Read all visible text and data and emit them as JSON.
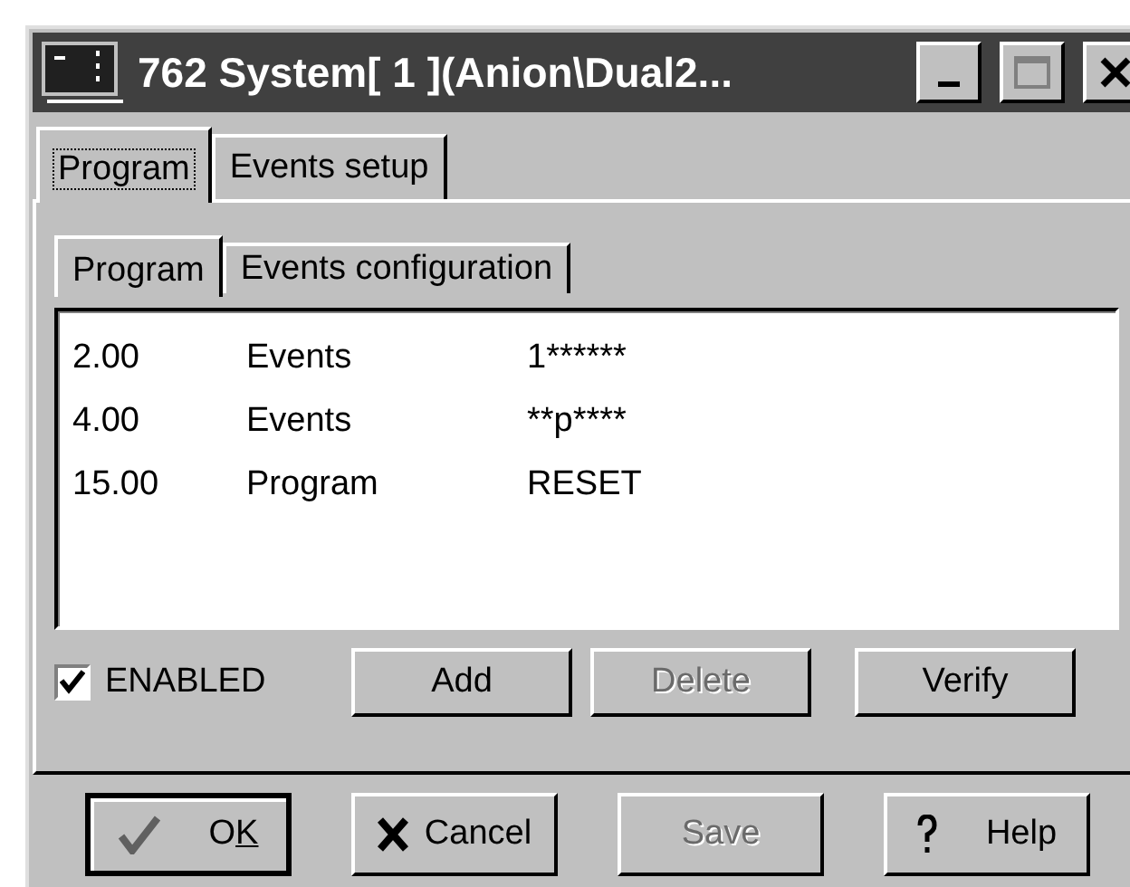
{
  "window": {
    "title": "762 System[ 1 ](Anion\\Dual2..."
  },
  "tabs": [
    {
      "label": "Program",
      "selected": true
    },
    {
      "label": "Events setup",
      "selected": false
    }
  ],
  "inner_tabs": [
    {
      "label": "Program",
      "selected": true
    },
    {
      "label": "Events configuration",
      "selected": false
    }
  ],
  "list": {
    "rows": [
      {
        "cells": [
          "2.00",
          "Events",
          "1******"
        ]
      },
      {
        "cells": [
          "4.00",
          "Events",
          "**p****"
        ]
      },
      {
        "cells": [
          "15.00",
          "Program",
          "RESET"
        ]
      }
    ]
  },
  "enabled": {
    "label": "ENABLED",
    "checked": true
  },
  "list_buttons": [
    {
      "label": "Add",
      "disabled": false
    },
    {
      "label": "Delete",
      "disabled": true
    },
    {
      "label": "Verify",
      "disabled": false
    }
  ],
  "buttons": [
    {
      "label_parts": [
        {
          "text": "O",
          "underlined": false
        },
        {
          "text": "K",
          "underlined": true
        }
      ],
      "kind": "ok",
      "disabled": false
    },
    {
      "label": "Cancel",
      "kind": "cancel",
      "disabled": false
    },
    {
      "label": "Save",
      "kind": "plain",
      "disabled": true
    },
    {
      "label": "Help",
      "kind": "help",
      "disabled": false
    }
  ]
}
